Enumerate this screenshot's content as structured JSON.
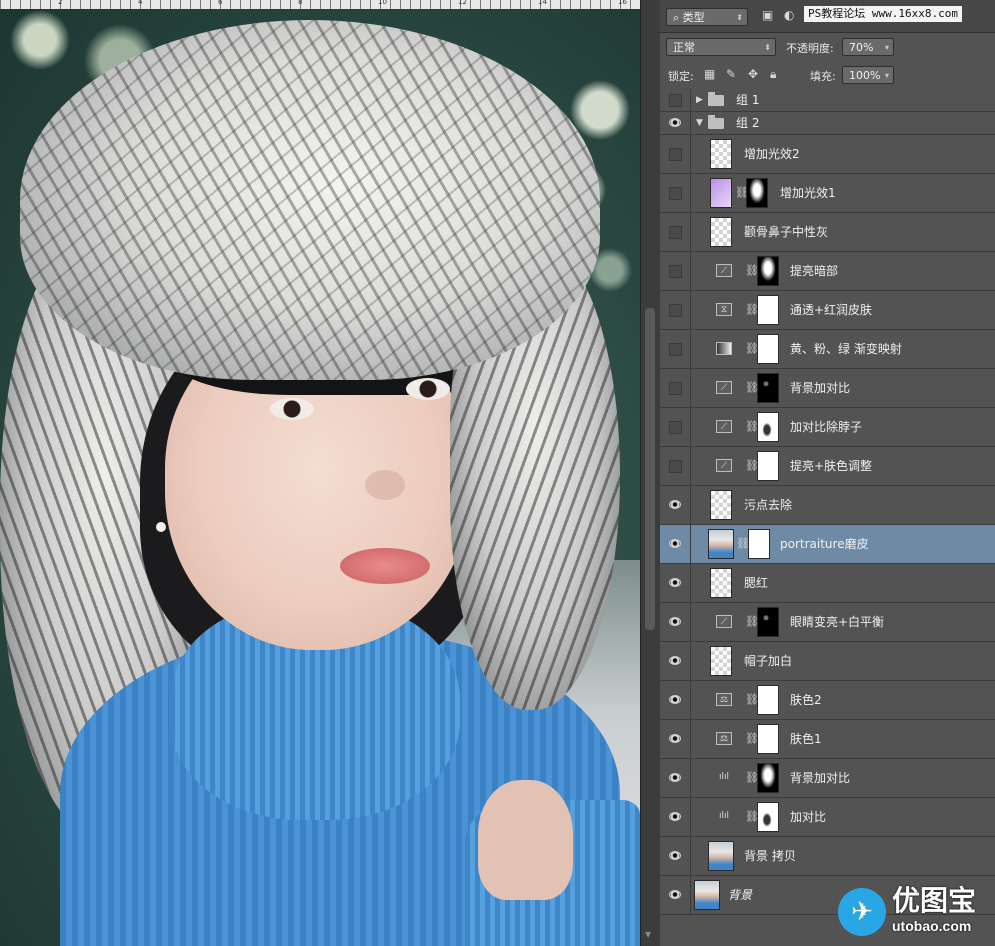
{
  "panel": {
    "filter_type": "类型",
    "watermark": "PS教程论坛 www.16xx8.com",
    "blend_mode": "正常",
    "opacity_label": "不透明度:",
    "opacity_value": "70%",
    "lock_label": "锁定:",
    "fill_label": "填充:",
    "fill_value": "100%"
  },
  "layers": [
    {
      "name": "组 1",
      "visible": false,
      "type": "group-collapsed"
    },
    {
      "name": "组 2",
      "visible": true,
      "type": "group-expanded"
    },
    {
      "name": "增加光效2",
      "visible": false,
      "type": "pixel"
    },
    {
      "name": "增加光效1",
      "visible": false,
      "type": "pixel-mask"
    },
    {
      "name": "颧骨鼻子中性灰",
      "visible": false,
      "type": "pixel"
    },
    {
      "name": "提亮暗部",
      "visible": false,
      "type": "curves"
    },
    {
      "name": "通透+红润皮肤",
      "visible": false,
      "type": "channel-mixer"
    },
    {
      "name": "黄、粉、绿 渐变映射",
      "visible": false,
      "type": "gradient-map"
    },
    {
      "name": "背景加对比",
      "visible": false,
      "type": "curves"
    },
    {
      "name": "加对比除脖子",
      "visible": false,
      "type": "curves"
    },
    {
      "name": "提亮+肤色调整",
      "visible": false,
      "type": "curves"
    },
    {
      "name": "污点去除",
      "visible": true,
      "type": "pixel"
    },
    {
      "name": "portraiture磨皮",
      "visible": true,
      "type": "photo-mask",
      "selected": true
    },
    {
      "name": "腮红",
      "visible": true,
      "type": "pixel"
    },
    {
      "name": "眼睛变亮+白平衡",
      "visible": true,
      "type": "curves"
    },
    {
      "name": "帽子加白",
      "visible": true,
      "type": "pixel"
    },
    {
      "name": "肤色2",
      "visible": true,
      "type": "color-balance"
    },
    {
      "name": "肤色1",
      "visible": true,
      "type": "color-balance"
    },
    {
      "name": "背景加对比",
      "visible": true,
      "type": "levels"
    },
    {
      "name": "加对比",
      "visible": true,
      "type": "levels"
    },
    {
      "name": "背景 拷贝",
      "visible": true,
      "type": "photo"
    },
    {
      "name": "背景",
      "visible": true,
      "type": "background"
    }
  ],
  "logo": {
    "cn": "优图宝",
    "url": "utobao.com"
  },
  "ruler": [
    "2",
    "4",
    "6",
    "8",
    "10",
    "12",
    "14",
    "16"
  ]
}
